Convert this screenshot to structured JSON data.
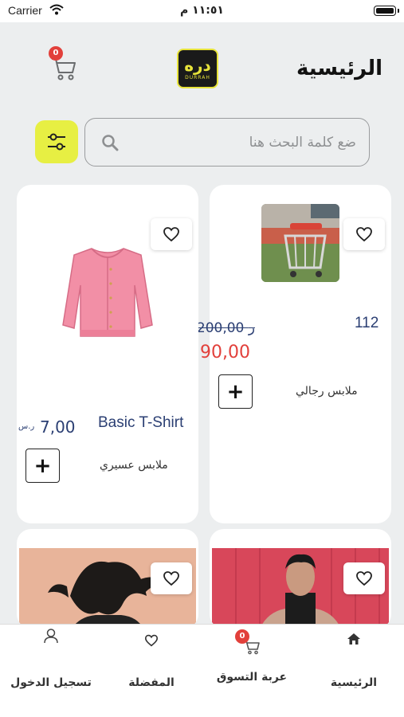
{
  "status_bar": {
    "carrier": "Carrier",
    "time": "١١:٥١ م"
  },
  "header": {
    "title": "الرئيسية",
    "logo_mark": "دره",
    "logo_sub": "DURRAH",
    "cart_count": "0"
  },
  "search": {
    "placeholder": "ضع كلمة البحث هنا"
  },
  "products": [
    {
      "image": "shopping-cart-photo",
      "name": "112",
      "old_price": "200,00 ر",
      "new_price": "90,00",
      "category": "ملابس رجالي"
    },
    {
      "image": "pink-cardigan",
      "name": "Basic T-Shirt",
      "price": "7,00",
      "currency": "ر.س",
      "category": "ملابس عسيري"
    },
    {
      "image": "man-portrait-red-wall"
    },
    {
      "image": "woman-hair-toss"
    }
  ],
  "tabs": [
    {
      "label": "الرئيسية",
      "icon": "home-icon"
    },
    {
      "label": "عربة التسوق",
      "icon": "cart-icon",
      "badge": "0"
    },
    {
      "label": "المفضلة",
      "icon": "heart-icon"
    },
    {
      "label": "تسجيل الدخول",
      "icon": "user-icon"
    }
  ],
  "colors": {
    "accent": "#e7ef43",
    "price_red": "#e2403b",
    "name_blue": "#2b3f73",
    "background": "#eceeef"
  }
}
